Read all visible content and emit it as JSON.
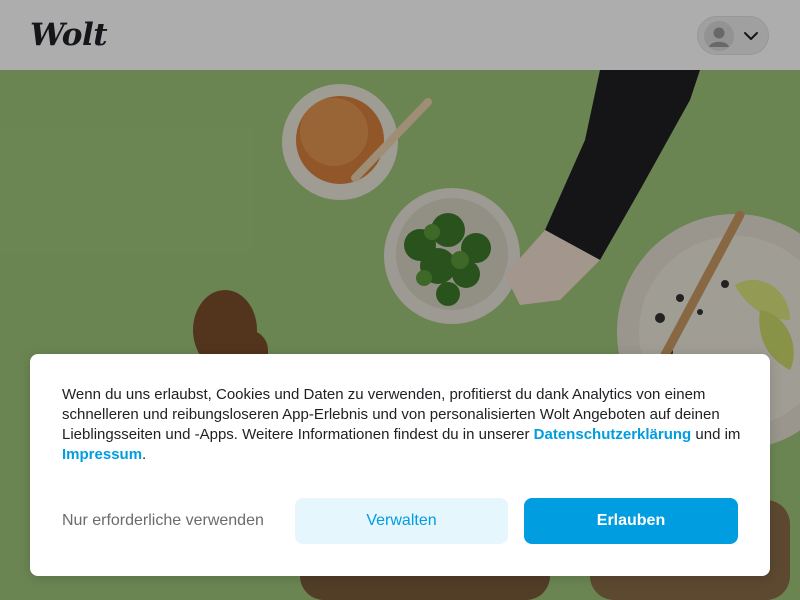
{
  "header": {
    "logo_text": "Wolt",
    "profile_icon": "user-avatar-icon",
    "menu_icon": "chevron-down-icon"
  },
  "hero": {
    "image_description_icon": "food-ingredients-photo"
  },
  "consent": {
    "text_before_link": "Wenn du uns erlaubst, Cookies und Daten zu verwenden, profitierst du dank Analytics von einem schnelleren und reibungsloseren App-Erlebnis und von personalisierten Wolt Angeboten auf deinen Lieblingsseiten und -Apps. Weitere Informationen findest du in unserer ",
    "privacy_link": "Datenschutzerklärung",
    "text_between_links": " und im ",
    "imprint_link": "Impressum",
    "text_after_links": ".",
    "necessary_only_label": "Nur erforderliche verwenden",
    "manage_label": "Verwalten",
    "allow_label": "Erlauben"
  },
  "colors": {
    "accent": "#009de0",
    "accent_light": "#e6f6fd",
    "text": "#202125",
    "muted_text": "#6b6b6b",
    "hero_background": "#9ec47a"
  }
}
